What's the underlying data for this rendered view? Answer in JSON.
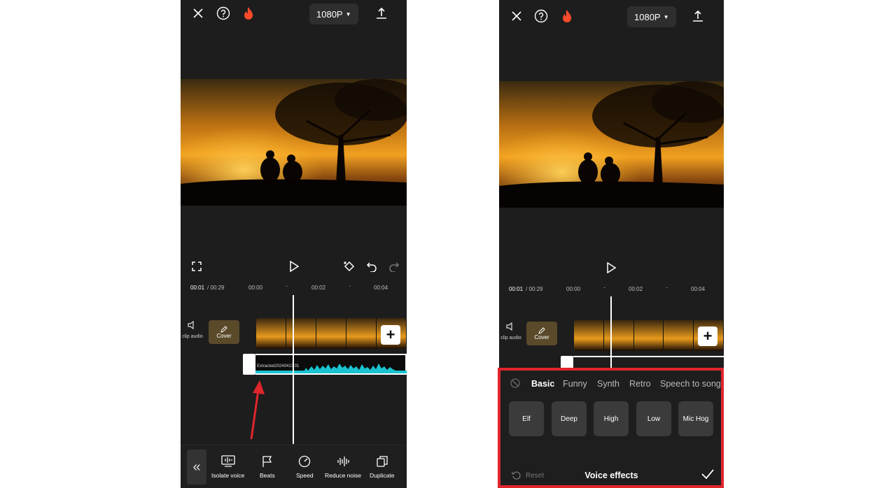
{
  "left": {
    "resolution": "1080P",
    "ruler": {
      "current": "00:01",
      "total": "/ 00:29",
      "ticks": [
        "00:00",
        "00:02",
        "00:04"
      ]
    },
    "track_side": {
      "audio_label": "clip audio",
      "cover_label": "Cover"
    },
    "audio_clip_name": "Extracted20240413 01",
    "toolbar": [
      {
        "label": "Isolate voice",
        "icon": "isolate-voice-icon"
      },
      {
        "label": "Beats",
        "icon": "flag-icon"
      },
      {
        "label": "Speed",
        "icon": "speed-icon"
      },
      {
        "label": "Reduce noise",
        "icon": "waveform-icon"
      },
      {
        "label": "Duplicate",
        "icon": "duplicate-icon"
      }
    ]
  },
  "right": {
    "resolution": "1080P",
    "ruler": {
      "current": "00:01",
      "total": "/ 00:29",
      "ticks": [
        "00:00",
        "00:02",
        "00:04"
      ]
    },
    "track_side": {
      "audio_label": "clip audio",
      "cover_label": "Cover"
    },
    "voice_effects": {
      "tabs": [
        "Basic",
        "Funny",
        "Synth",
        "Retro",
        "Speech to song"
      ],
      "active_tab": "Basic",
      "effects": [
        "Elf",
        "Deep",
        "High",
        "Low",
        "Mic Hog"
      ],
      "reset_label": "Reset",
      "title": "Voice effects"
    }
  },
  "colors": {
    "accent_red": "#e0252c",
    "audio_wave": "#19c3cf",
    "fire": "#ff4b2b"
  }
}
